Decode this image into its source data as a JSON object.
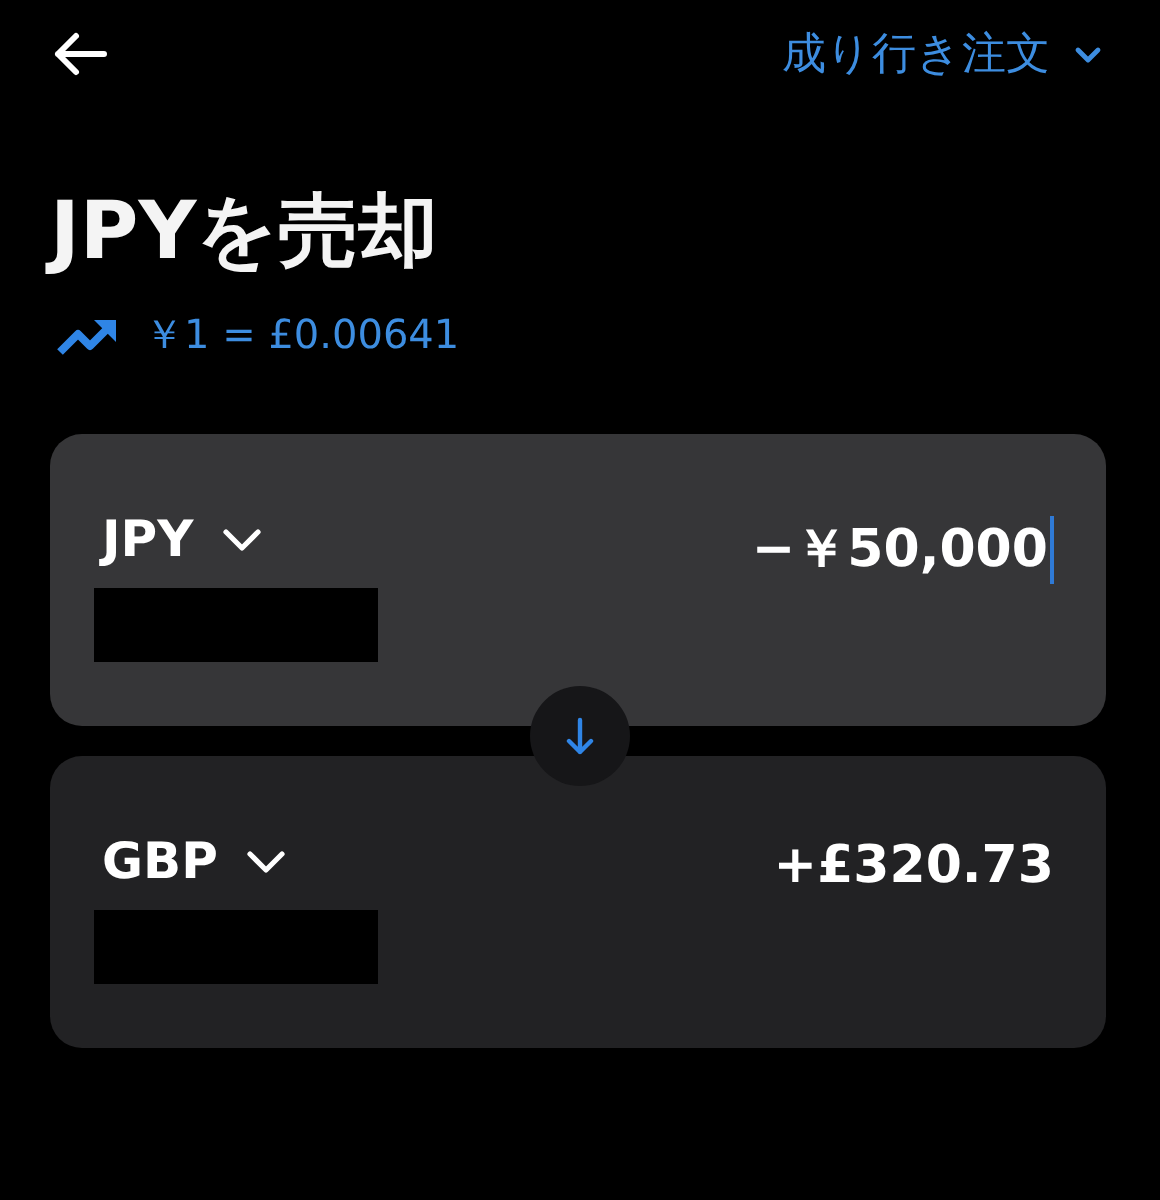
{
  "header": {
    "order_type": "成り行き注文"
  },
  "title": "JPYを売却",
  "rate": "￥1 = £0.00641",
  "cards": [
    {
      "currency": "JPY",
      "amount": "−￥50,000",
      "selected": true
    },
    {
      "currency": "GBP",
      "amount": "+£320.73",
      "selected": false
    }
  ]
}
